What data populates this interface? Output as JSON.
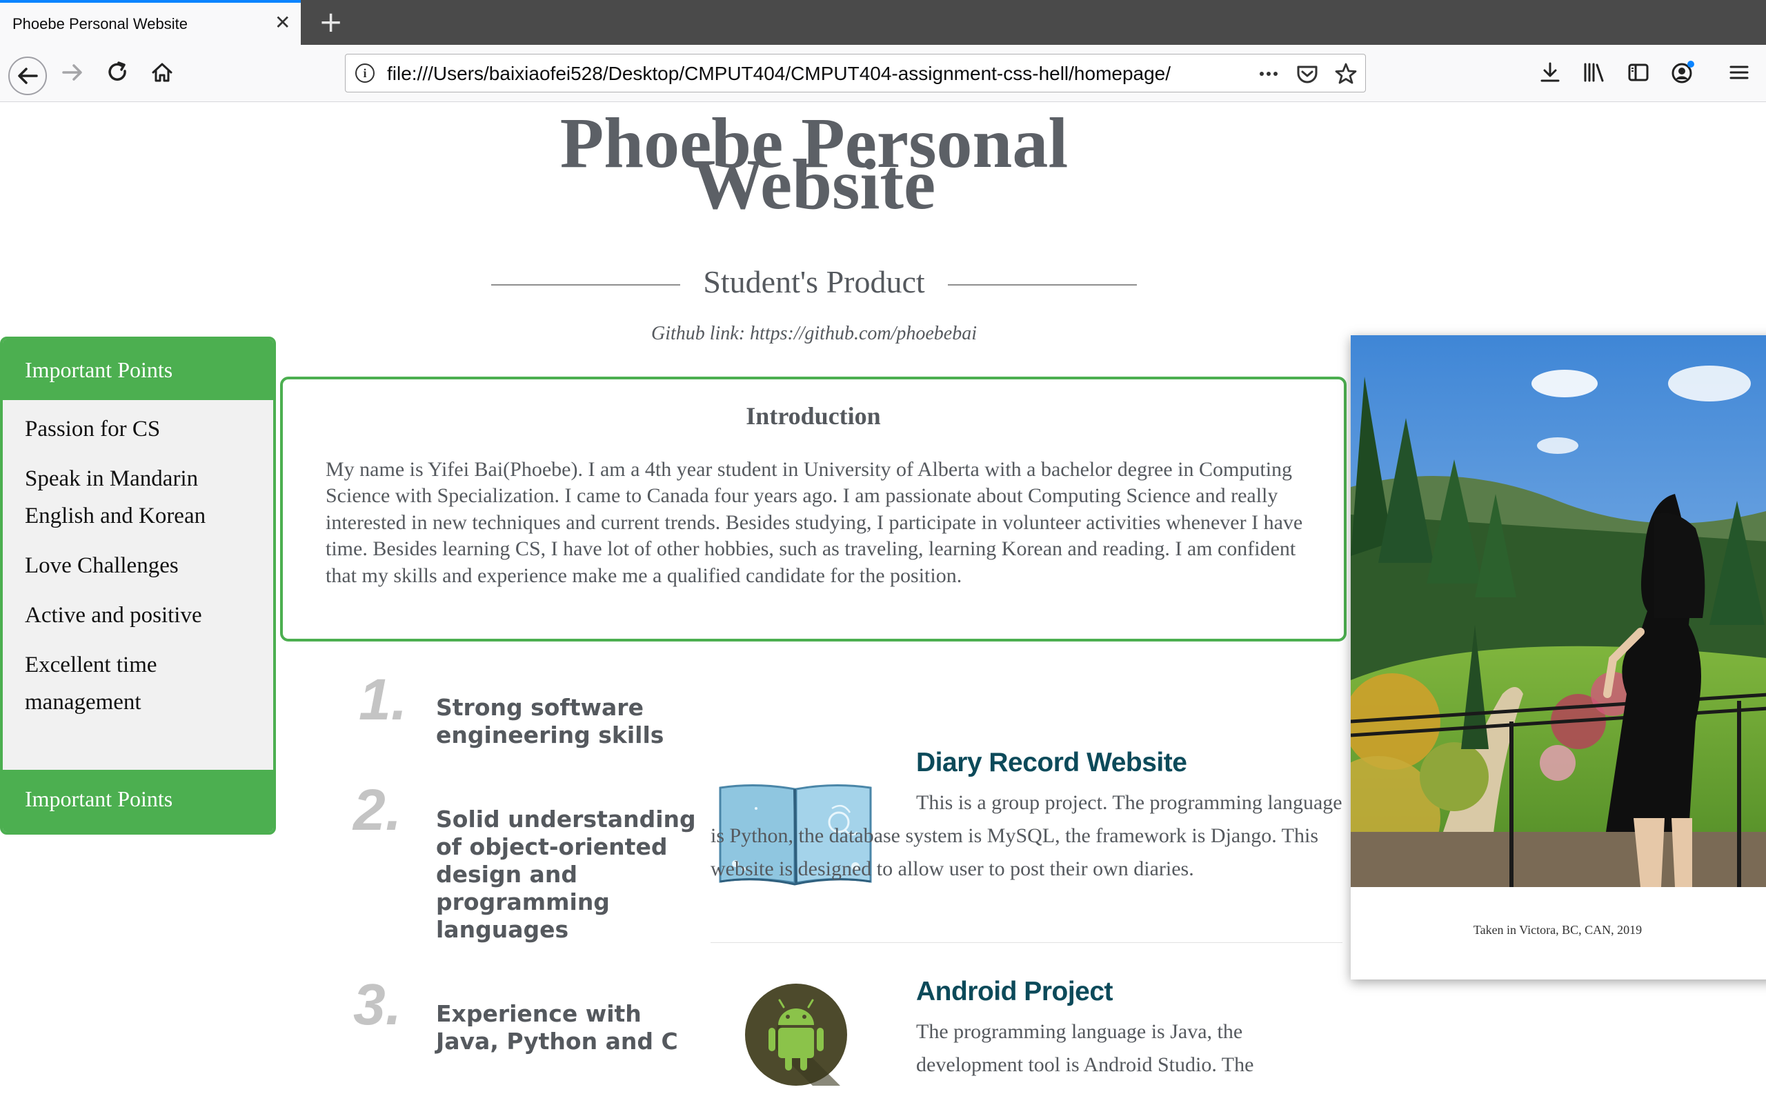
{
  "browser": {
    "tab_title": "Phoebe Personal Website",
    "tab_close": "✕",
    "new_tab": "+",
    "url": "file:///Users/baixiaofei528/Desktop/CMPUT404/CMPUT404-assignment-css-hell/homepage/",
    "url_info_glyph": "i",
    "icons": [
      "back-icon",
      "forward-icon",
      "reload-icon",
      "home-icon",
      "info-icon",
      "more-icon",
      "pocket-icon",
      "star-icon",
      "download-icon",
      "library-icon",
      "sidebar-icon",
      "account-icon",
      "menu-icon"
    ],
    "accent": "#0a84ff"
  },
  "header": {
    "title_line1": "Phoebe Personal",
    "title_line2": "Website",
    "subtitle": "Student's Product",
    "github": "Github link: https://github.com/phoebebai"
  },
  "sidebar": {
    "header": "Important Points",
    "items": [
      {
        "label": "Passion for CS"
      },
      {
        "label": "Speak in Mandarin English and Korean"
      },
      {
        "label": "Love Challenges"
      },
      {
        "label": "Active and positive"
      },
      {
        "label": "Excellent time management"
      }
    ],
    "footer": "Important Points",
    "accent": "#4caf50"
  },
  "intro": {
    "title": "Introduction",
    "text": "My name is Yifei Bai(Phoebe). I am a 4th year student in University of Alberta with a bachelor degree in Computing Science with Specialization. I came to Canada four years ago. I am passionate about Computing Science and really interested in new techniques and current trends. Besides studying, I participate in volunteer activities whenever I have time. Besides learning CS, I have lot of other hobbies, such as traveling, learning Korean and reading. I am confident that my skills and experience make me a qualified candidate for the position."
  },
  "skills": [
    {
      "num": "1.",
      "text": "Strong software engineering skills"
    },
    {
      "num": "2.",
      "text": "Solid understanding of object-oriented design and programming languages"
    },
    {
      "num": "3.",
      "text": "Experience with Java, Python and C"
    }
  ],
  "projects": [
    {
      "title": "Diary Record Website",
      "text": "This is a group project. The programming language is Python, the database system is MySQL, the framework is Django. This website is designed to allow user to post their own diaries.",
      "image": "book-image"
    },
    {
      "title": "Android Project",
      "text": "The programming language is Java, the development tool is Android Studio. The",
      "image": "android-icon"
    }
  ],
  "photo": {
    "caption": "Taken in Victora, BC, CAN, 2019"
  }
}
